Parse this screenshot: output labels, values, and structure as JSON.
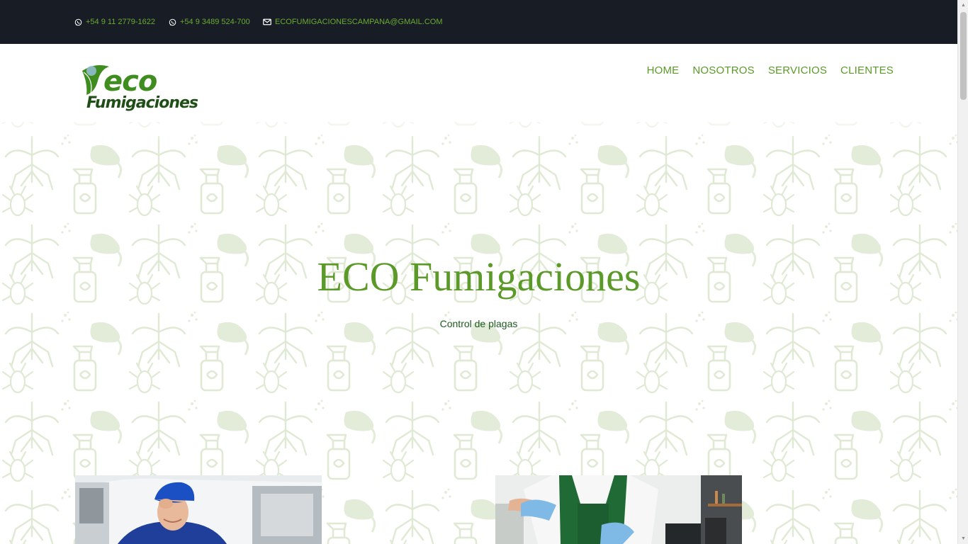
{
  "topbar": {
    "phone1": "+54 9 11 2779-1622",
    "phone2": "+54 9 3489 524-700",
    "email": "ECOFUMIGACIONESCAMPANA@GMAIL.COM"
  },
  "logo": {
    "eco": "eco",
    "sub": "Fumigaciones"
  },
  "nav": [
    "HOME",
    "NOSOTROS",
    "SERVICIOS",
    "CLIENTES"
  ],
  "hero": {
    "title": "ECO Fumigaciones",
    "subtitle": "Control de plagas"
  },
  "colors": {
    "brand_green": "#5b9a28",
    "topbar_bg": "#181d25",
    "subtitle_green": "#1e5a20"
  },
  "icons": {
    "phone": "whatsapp-icon",
    "email": "envelope-icon"
  }
}
